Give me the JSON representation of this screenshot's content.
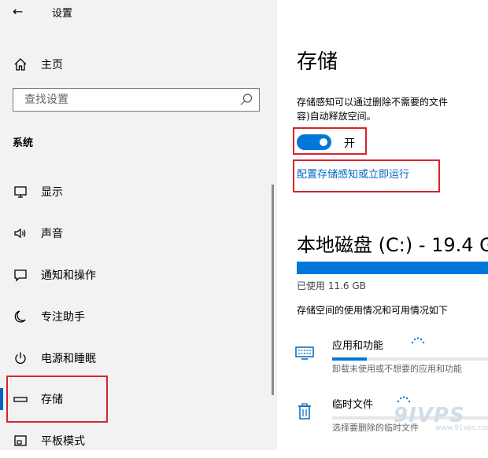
{
  "window": {
    "back_label": "←",
    "title": "设置"
  },
  "sidebar": {
    "home_label": "主页",
    "search_placeholder": "查找设置",
    "section_title": "系统",
    "items": [
      {
        "label": "显示",
        "icon": "monitor-icon"
      },
      {
        "label": "声音",
        "icon": "speaker-icon"
      },
      {
        "label": "通知和操作",
        "icon": "notification-icon"
      },
      {
        "label": "专注助手",
        "icon": "moon-icon"
      },
      {
        "label": "电源和睡眠",
        "icon": "power-icon"
      },
      {
        "label": "存储",
        "icon": "storage-icon",
        "selected": true
      },
      {
        "label": "平板模式",
        "icon": "tablet-mode-icon"
      }
    ]
  },
  "main": {
    "title": "存储",
    "description_line1": "存储感知可以通过删除不需要的文件",
    "description_line2": "容)自动释放空间。",
    "toggle": {
      "state_label": "开",
      "on": true
    },
    "configure_link": "配置存储感知或立即运行",
    "disk": {
      "title": "本地磁盘 (C:) - 19.4 G",
      "used_label": "已使用 11.6 GB",
      "usage_description": "存储空间的使用情况和可用情况如下"
    },
    "categories": [
      {
        "name": "应用和功能",
        "subtitle": "卸载未使用或不想要的应用和功能",
        "progress": 0.22,
        "icon": "apps-keyboard-icon"
      },
      {
        "name": "临时文件",
        "subtitle": "选择要删除的临时文件",
        "progress": 0.0,
        "icon": "trash-icon"
      }
    ]
  },
  "watermark": {
    "text": "9IVPS",
    "url": "www.91vps.com"
  },
  "colors": {
    "accent": "#0078d7",
    "link": "#0067c0",
    "highlight": "#d9232b",
    "sidebar_bg": "#f2f2f2"
  }
}
